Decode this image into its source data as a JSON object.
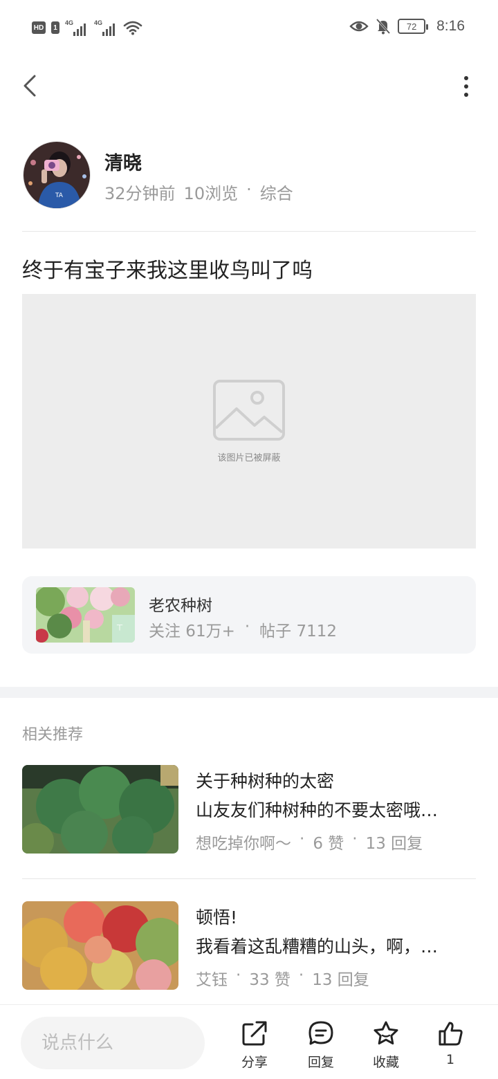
{
  "status_bar": {
    "hd_label": "HD",
    "sim_label": "1",
    "signal1_tag": "4G",
    "signal2_tag": "4G",
    "battery": "72",
    "time": "8:16"
  },
  "post": {
    "author_name": "清晓",
    "time_ago": "32分钟前",
    "views": "10浏览",
    "separator": "·",
    "category": "综合",
    "title": "终于有宝子来我这里收鸟叫了呜",
    "blocked_image_text": "该图片已被屏蔽"
  },
  "forum": {
    "name": "老农种树",
    "followers": "关注 61万+",
    "separator": "·",
    "posts": "帖子 7112"
  },
  "recommendations": {
    "heading": "相关推荐",
    "items": [
      {
        "title": "关于种树种的太密",
        "desc": "山友友们种树种的不要太密哦…",
        "author": "想吃掉你啊～",
        "sep1": "·",
        "likes": "6 赞",
        "sep2": "·",
        "replies": "13 回复"
      },
      {
        "title": "顿悟!",
        "desc": "我看着这乱糟糟的山头，啊，…",
        "author": "艾钰",
        "sep1": "·",
        "likes": "33 赞",
        "sep2": "·",
        "replies": "13 回复"
      }
    ]
  },
  "bottom_bar": {
    "comment_placeholder": "说点什么",
    "share_label": "分享",
    "reply_label": "回复",
    "favorite_label": "收藏",
    "like_count": "1"
  }
}
